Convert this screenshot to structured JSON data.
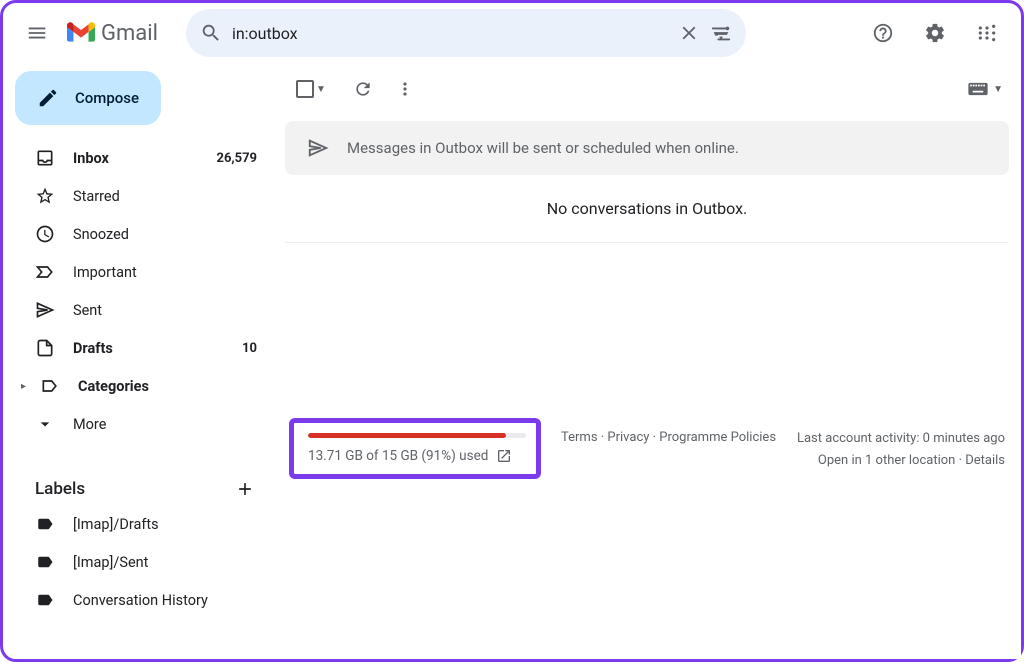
{
  "app": {
    "name": "Gmail"
  },
  "search": {
    "value": "in:outbox"
  },
  "compose": {
    "label": "Compose"
  },
  "nav": [
    {
      "label": "Inbox",
      "count": "26,579",
      "bold": true
    },
    {
      "label": "Starred",
      "count": "",
      "bold": false
    },
    {
      "label": "Snoozed",
      "count": "",
      "bold": false
    },
    {
      "label": "Important",
      "count": "",
      "bold": false
    },
    {
      "label": "Sent",
      "count": "",
      "bold": false
    },
    {
      "label": "Drafts",
      "count": "10",
      "bold": true
    },
    {
      "label": "Categories",
      "count": "",
      "bold": true
    },
    {
      "label": "More",
      "count": "",
      "bold": false
    }
  ],
  "labels": {
    "header": "Labels",
    "items": [
      {
        "label": "[Imap]/Drafts"
      },
      {
        "label": "[Imap]/Sent"
      },
      {
        "label": "Conversation History"
      }
    ]
  },
  "banner": {
    "text": "Messages in Outbox will be sent or scheduled when online."
  },
  "empty": {
    "text": "No conversations in Outbox."
  },
  "storage": {
    "percent": 91,
    "text": "13.71 GB of 15 GB (91%) used"
  },
  "footerLinks": {
    "terms": "Terms",
    "privacy": "Privacy",
    "programme": "Programme Policies"
  },
  "activity": {
    "last": "Last account activity: 0 minutes ago",
    "open": "Open in 1 other location",
    "details": "Details"
  }
}
